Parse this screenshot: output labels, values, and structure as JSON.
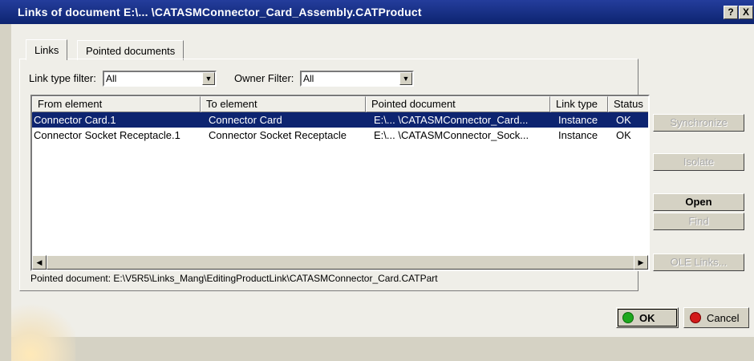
{
  "window": {
    "title": "Links of document E:\\... \\CATASMConnector_Card_Assembly.CATProduct",
    "help_glyph": "?",
    "close_glyph": "X"
  },
  "tabs": [
    {
      "label": "Links"
    },
    {
      "label": "Pointed documents"
    }
  ],
  "filters": {
    "link_type_label": "Link type filter:",
    "link_type_value": "All",
    "owner_label": "Owner Filter:",
    "owner_value": "All"
  },
  "table": {
    "columns": [
      "From element",
      "To element",
      "Pointed document",
      "Link type",
      "Status"
    ],
    "rows": [
      [
        "Connector Card.1",
        "Connector Card",
        "E:\\... \\CATASMConnector_Card...",
        "Instance",
        "OK"
      ],
      [
        "Connector Socket Receptacle.1",
        "Connector Socket Receptacle",
        "E:\\... \\CATASMConnector_Sock...",
        "Instance",
        "OK"
      ]
    ],
    "selected_row": 0
  },
  "buttons": {
    "synchronize": "Synchronize",
    "isolate": "Isolate",
    "open": "Open",
    "find": "Find",
    "ole_links": "OLE Links...",
    "ok": "OK",
    "cancel": "Cancel"
  },
  "pointed_document": "Pointed document: E:\\V5R5\\Links_Mang\\EditingProductLink\\CATASMConnector_Card.CATPart",
  "icons": {
    "ok": "green-circle-icon",
    "cancel": "red-circle-icon",
    "scroll_left": "◀",
    "scroll_right": "▶",
    "dropdown": "▼"
  },
  "colors": {
    "title_bar": "#0d2470",
    "selection": "#0d2470",
    "ok_icon": "#1ea81e",
    "cancel_icon": "#d21a1a"
  }
}
